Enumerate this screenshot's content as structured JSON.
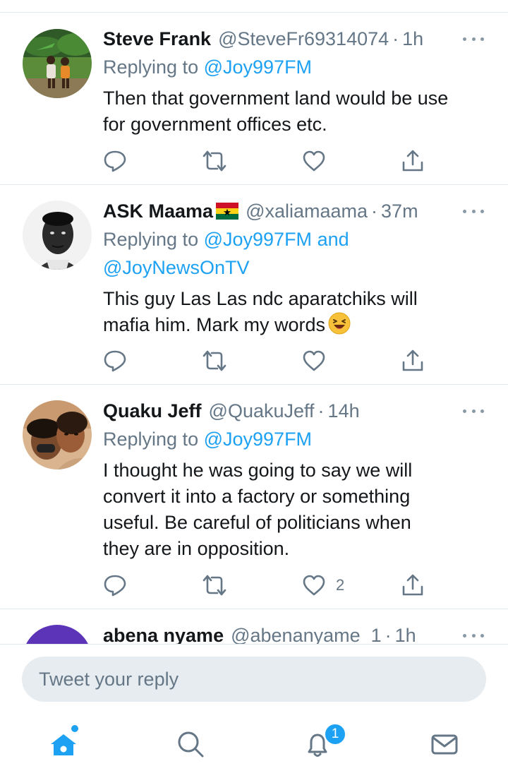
{
  "tweets": [
    {
      "name": "Steve Frank",
      "handle": "@SteveFr69314074",
      "time": "1h",
      "replying_prefix": "Replying to ",
      "replying_to": "@Joy997FM",
      "replying_more": "",
      "replying_line2": "",
      "lines": [
        "Then that government land would be use",
        "for government offices etc."
      ],
      "like_count": ""
    },
    {
      "name": "ASK Maama",
      "handle": "@xaliamaama",
      "time": "37m",
      "replying_prefix": "Replying to ",
      "replying_to": "@Joy997FM",
      "replying_more": " and",
      "replying_line2": "@JoyNewsOnTV",
      "lines": [
        "This guy Las Las ndc aparatchiks will",
        "mafia him. Mark my words"
      ],
      "like_count": ""
    },
    {
      "name": "Quaku Jeff",
      "handle": "@QuakuJeff",
      "time": "14h",
      "replying_prefix": "Replying to ",
      "replying_to": "@Joy997FM",
      "replying_more": "",
      "replying_line2": "",
      "lines": [
        "I thought he was going to say we will",
        "convert it into a factory or something",
        "useful. Be careful of politicians when",
        "they are in opposition."
      ],
      "like_count": "2"
    },
    {
      "name": "abena nyame",
      "handle": "@abenanyame_1",
      "time": "1h"
    }
  ],
  "separator": "·",
  "reply_box": {
    "placeholder": "Tweet your reply"
  },
  "nav": {
    "items": [
      "home-icon",
      "search-icon",
      "notifications-icon",
      "messages-icon"
    ],
    "notification_badge": "1"
  },
  "colors": {
    "accent": "#1da1f2",
    "text_primary": "#14171a",
    "text_secondary": "#657786",
    "divider": "#e1e8ed"
  }
}
